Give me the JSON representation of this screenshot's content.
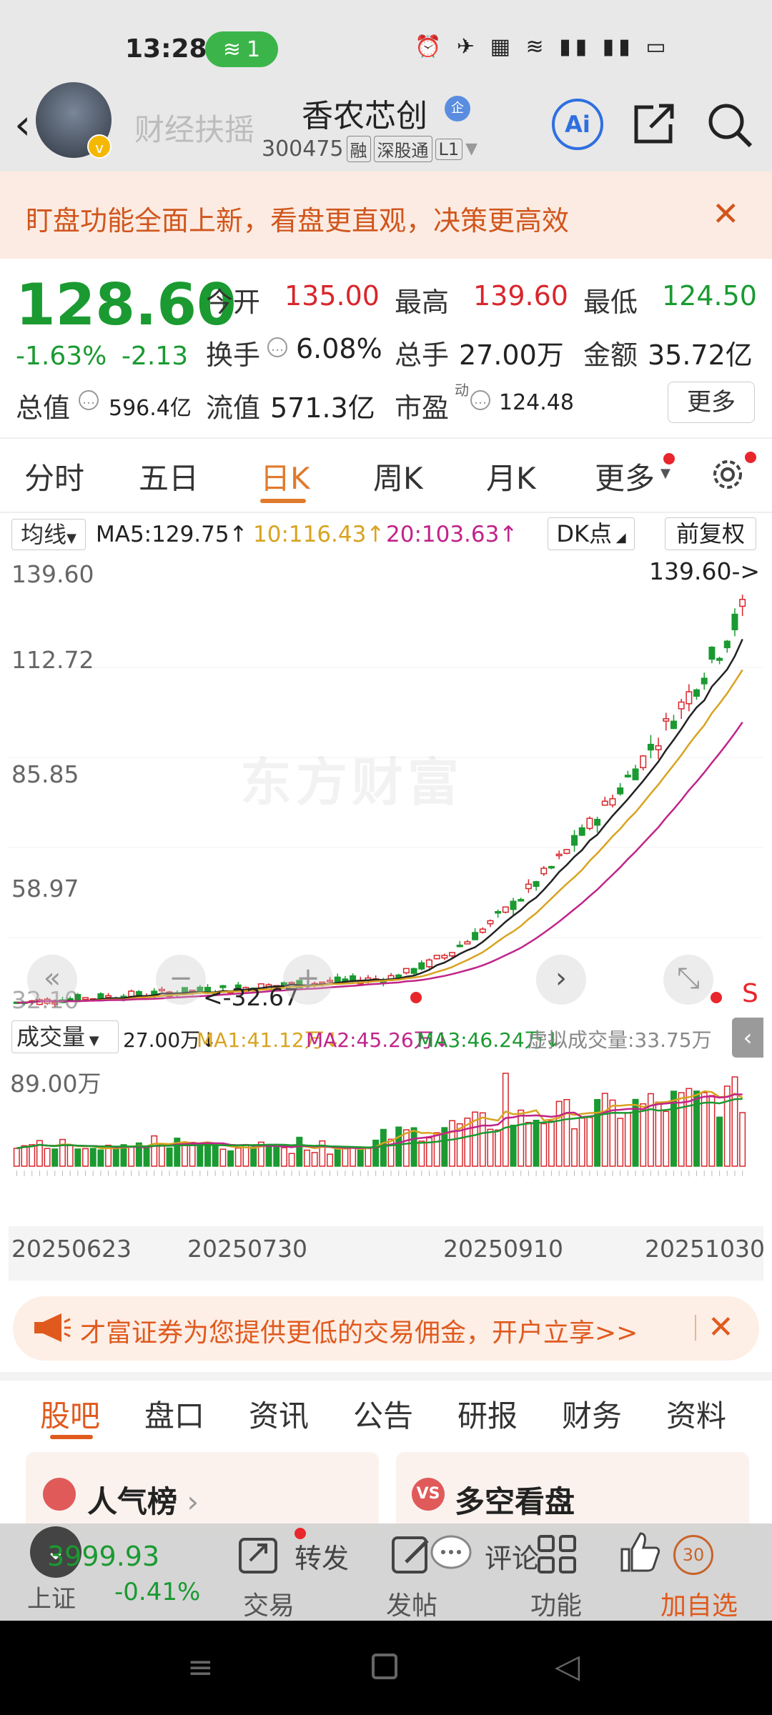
{
  "status_bar": {
    "time": "13:28",
    "wifi_badge": "1",
    "icons": "⏰ ✈ ▦ ≋ ▮▮ ▮▮ ▭"
  },
  "header": {
    "account_name": "财经扶摇",
    "stock_name": "香农芯创",
    "qi_badge": "企",
    "stock_code": "300475",
    "tags": [
      "融",
      "深股通",
      "L1"
    ],
    "ai_label": "Ai"
  },
  "banner": {
    "text": "盯盘功能全面上新，看盘更直观，决策更高效",
    "close": "✕"
  },
  "quote": {
    "price": "128.60",
    "pct_change": "-1.63%",
    "abs_change": "-2.13",
    "open_label": "今开",
    "open": "135.00",
    "high_label": "最高",
    "high": "139.60",
    "low_label": "最低",
    "low": "124.50",
    "turnover_label": "换手",
    "turnover": "6.08%",
    "volume_label": "总手",
    "volume": "27.00万",
    "amount_label": "金额",
    "amount": "35.72亿",
    "mktcap_label": "总值",
    "mktcap": "596.4亿",
    "float_label": "流值",
    "float": "571.3亿",
    "pe_label": "市盈",
    "pe_sup": "动",
    "pe": "124.48",
    "more_label": "更多"
  },
  "period_tabs": [
    "分时",
    "五日",
    "日K",
    "周K",
    "月K",
    "更多"
  ],
  "ma_legend": {
    "select": "均线",
    "ma5": "MA5:129.75↑",
    "ma10": "10:116.43↑",
    "ma20": "20:103.63↑",
    "dk": "DK点",
    "fq": "前复权"
  },
  "chart": {
    "watermark": "东方财富",
    "high_marker": "139.60->",
    "low_marker": "<-32.67",
    "y_labels": [
      "139.60",
      "112.72",
      "85.85",
      "58.97",
      "32.10"
    ],
    "s_label": "S"
  },
  "volume": {
    "select": "成交量",
    "value": "27.00万↓",
    "ma1": "MA1:41.12万↓",
    "ma2": "MA2:45.26万↓",
    "ma3": "MA3:46.24万↓",
    "virtual": "虚拟成交量:33.75万",
    "max_label": "89.00万",
    "dates": [
      "20250623",
      "20250730",
      "20250910",
      "20251030"
    ]
  },
  "chart_data": {
    "type": "candlestick",
    "y_range": [
      32.1,
      139.6
    ],
    "high": 139.6,
    "low": 32.67,
    "ma": {
      "MA5": 129.75,
      "MA10": 116.43,
      "MA20": 103.63
    },
    "volume_max": "89.00万",
    "x_labels": [
      "20250623",
      "20250730",
      "20250910",
      "20251030"
    ]
  },
  "ad": {
    "text": "才富证券为您提供更低的交易佣金，开户立享>>",
    "close": "✕"
  },
  "bottom_tabs": [
    "股吧",
    "盘口",
    "资讯",
    "公告",
    "研报",
    "财务",
    "资料"
  ],
  "cards": {
    "left": "人气榜",
    "right": "多空看盘",
    "right_icon": "VS"
  },
  "toolbar": {
    "index_value": "3999.93",
    "index_name": "上证",
    "index_change": "-0.41%",
    "trade": "交易",
    "forward": "转发",
    "post": "发帖",
    "comment": "评论",
    "function": "功能",
    "fav": "加自选",
    "count": "30"
  },
  "colors": {
    "up": "#d8262c",
    "down": "#1a9a31",
    "accent": "#e07a2d",
    "ma10": "#d8a320",
    "ma20": "#c0248a"
  }
}
